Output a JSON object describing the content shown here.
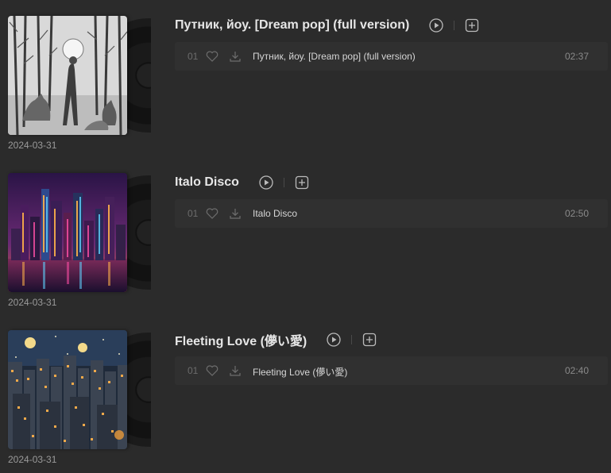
{
  "albums": [
    {
      "title": "Путник, йоу. [Dream pop] (full version)",
      "date": "2024-03-31",
      "cover_icon": "forest-wolves-cover-art",
      "track": {
        "number": "01",
        "name": "Путник, йоу. [Dream pop] (full version)",
        "duration": "02:37"
      }
    },
    {
      "title": "Italo Disco",
      "date": "2024-03-31",
      "cover_icon": "neon-city-cover-art",
      "track": {
        "number": "01",
        "name": "Italo Disco",
        "duration": "02:50"
      }
    },
    {
      "title": "Fleeting Love (儚い愛)",
      "date": "2024-03-31",
      "cover_icon": "night-city-cover-art",
      "track": {
        "number": "01",
        "name": "Fleeting Love (儚い愛)",
        "duration": "02:40"
      }
    }
  ],
  "icons": {
    "play": "play-circle-icon",
    "add": "add-to-playlist-icon",
    "favorite": "heart-icon",
    "download": "download-icon"
  },
  "colors": {
    "background": "#2b2b2b",
    "track_row": "#303030",
    "text": "#d6d6d6",
    "muted": "#8a8a8a"
  }
}
